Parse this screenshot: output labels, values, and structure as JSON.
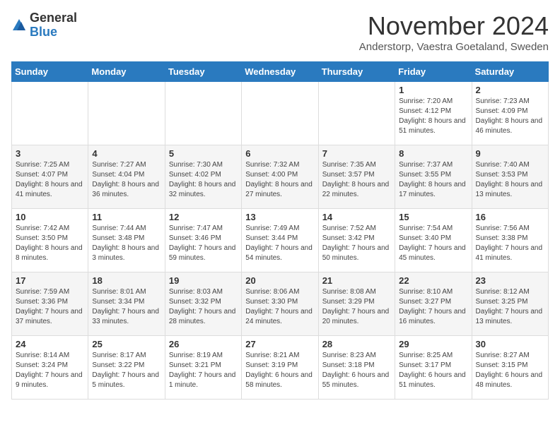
{
  "logo": {
    "text_general": "General",
    "text_blue": "Blue"
  },
  "title": "November 2024",
  "subtitle": "Anderstorp, Vaestra Goetaland, Sweden",
  "days_of_week": [
    "Sunday",
    "Monday",
    "Tuesday",
    "Wednesday",
    "Thursday",
    "Friday",
    "Saturday"
  ],
  "weeks": [
    [
      {
        "day": "",
        "info": ""
      },
      {
        "day": "",
        "info": ""
      },
      {
        "day": "",
        "info": ""
      },
      {
        "day": "",
        "info": ""
      },
      {
        "day": "",
        "info": ""
      },
      {
        "day": "1",
        "info": "Sunrise: 7:20 AM\nSunset: 4:12 PM\nDaylight: 8 hours and 51 minutes."
      },
      {
        "day": "2",
        "info": "Sunrise: 7:23 AM\nSunset: 4:09 PM\nDaylight: 8 hours and 46 minutes."
      }
    ],
    [
      {
        "day": "3",
        "info": "Sunrise: 7:25 AM\nSunset: 4:07 PM\nDaylight: 8 hours and 41 minutes."
      },
      {
        "day": "4",
        "info": "Sunrise: 7:27 AM\nSunset: 4:04 PM\nDaylight: 8 hours and 36 minutes."
      },
      {
        "day": "5",
        "info": "Sunrise: 7:30 AM\nSunset: 4:02 PM\nDaylight: 8 hours and 32 minutes."
      },
      {
        "day": "6",
        "info": "Sunrise: 7:32 AM\nSunset: 4:00 PM\nDaylight: 8 hours and 27 minutes."
      },
      {
        "day": "7",
        "info": "Sunrise: 7:35 AM\nSunset: 3:57 PM\nDaylight: 8 hours and 22 minutes."
      },
      {
        "day": "8",
        "info": "Sunrise: 7:37 AM\nSunset: 3:55 PM\nDaylight: 8 hours and 17 minutes."
      },
      {
        "day": "9",
        "info": "Sunrise: 7:40 AM\nSunset: 3:53 PM\nDaylight: 8 hours and 13 minutes."
      }
    ],
    [
      {
        "day": "10",
        "info": "Sunrise: 7:42 AM\nSunset: 3:50 PM\nDaylight: 8 hours and 8 minutes."
      },
      {
        "day": "11",
        "info": "Sunrise: 7:44 AM\nSunset: 3:48 PM\nDaylight: 8 hours and 3 minutes."
      },
      {
        "day": "12",
        "info": "Sunrise: 7:47 AM\nSunset: 3:46 PM\nDaylight: 7 hours and 59 minutes."
      },
      {
        "day": "13",
        "info": "Sunrise: 7:49 AM\nSunset: 3:44 PM\nDaylight: 7 hours and 54 minutes."
      },
      {
        "day": "14",
        "info": "Sunrise: 7:52 AM\nSunset: 3:42 PM\nDaylight: 7 hours and 50 minutes."
      },
      {
        "day": "15",
        "info": "Sunrise: 7:54 AM\nSunset: 3:40 PM\nDaylight: 7 hours and 45 minutes."
      },
      {
        "day": "16",
        "info": "Sunrise: 7:56 AM\nSunset: 3:38 PM\nDaylight: 7 hours and 41 minutes."
      }
    ],
    [
      {
        "day": "17",
        "info": "Sunrise: 7:59 AM\nSunset: 3:36 PM\nDaylight: 7 hours and 37 minutes."
      },
      {
        "day": "18",
        "info": "Sunrise: 8:01 AM\nSunset: 3:34 PM\nDaylight: 7 hours and 33 minutes."
      },
      {
        "day": "19",
        "info": "Sunrise: 8:03 AM\nSunset: 3:32 PM\nDaylight: 7 hours and 28 minutes."
      },
      {
        "day": "20",
        "info": "Sunrise: 8:06 AM\nSunset: 3:30 PM\nDaylight: 7 hours and 24 minutes."
      },
      {
        "day": "21",
        "info": "Sunrise: 8:08 AM\nSunset: 3:29 PM\nDaylight: 7 hours and 20 minutes."
      },
      {
        "day": "22",
        "info": "Sunrise: 8:10 AM\nSunset: 3:27 PM\nDaylight: 7 hours and 16 minutes."
      },
      {
        "day": "23",
        "info": "Sunrise: 8:12 AM\nSunset: 3:25 PM\nDaylight: 7 hours and 13 minutes."
      }
    ],
    [
      {
        "day": "24",
        "info": "Sunrise: 8:14 AM\nSunset: 3:24 PM\nDaylight: 7 hours and 9 minutes."
      },
      {
        "day": "25",
        "info": "Sunrise: 8:17 AM\nSunset: 3:22 PM\nDaylight: 7 hours and 5 minutes."
      },
      {
        "day": "26",
        "info": "Sunrise: 8:19 AM\nSunset: 3:21 PM\nDaylight: 7 hours and 1 minute."
      },
      {
        "day": "27",
        "info": "Sunrise: 8:21 AM\nSunset: 3:19 PM\nDaylight: 6 hours and 58 minutes."
      },
      {
        "day": "28",
        "info": "Sunrise: 8:23 AM\nSunset: 3:18 PM\nDaylight: 6 hours and 55 minutes."
      },
      {
        "day": "29",
        "info": "Sunrise: 8:25 AM\nSunset: 3:17 PM\nDaylight: 6 hours and 51 minutes."
      },
      {
        "day": "30",
        "info": "Sunrise: 8:27 AM\nSunset: 3:15 PM\nDaylight: 6 hours and 48 minutes."
      }
    ]
  ]
}
